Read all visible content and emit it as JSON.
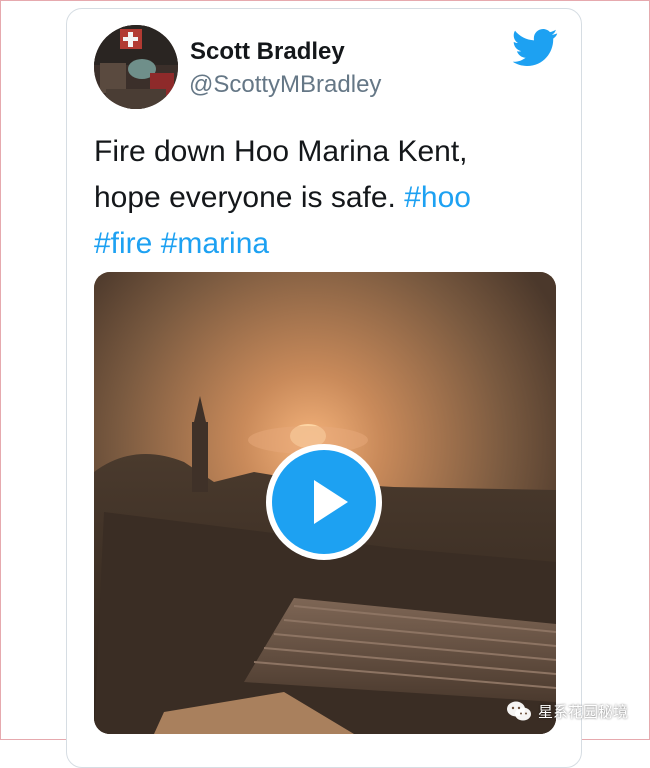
{
  "tweet": {
    "author_name": "Scott Bradley",
    "author_handle": "@ScottyMBradley",
    "text_plain": "Fire down Hoo Marina Kent, hope everyone is safe.",
    "hashtags": [
      "#hoo",
      "#fire",
      "#marina"
    ]
  },
  "media": {
    "type": "video",
    "play_icon": "play-icon"
  },
  "watermark": {
    "text": "星系花园秘境",
    "icon": "wechat-icon"
  },
  "icons": {
    "brand": "twitter-bird-icon"
  },
  "colors": {
    "link": "#1da1f2",
    "text": "#14171a",
    "muted": "#657786",
    "border": "#d6dde3",
    "frame": "#e6a9ae"
  }
}
